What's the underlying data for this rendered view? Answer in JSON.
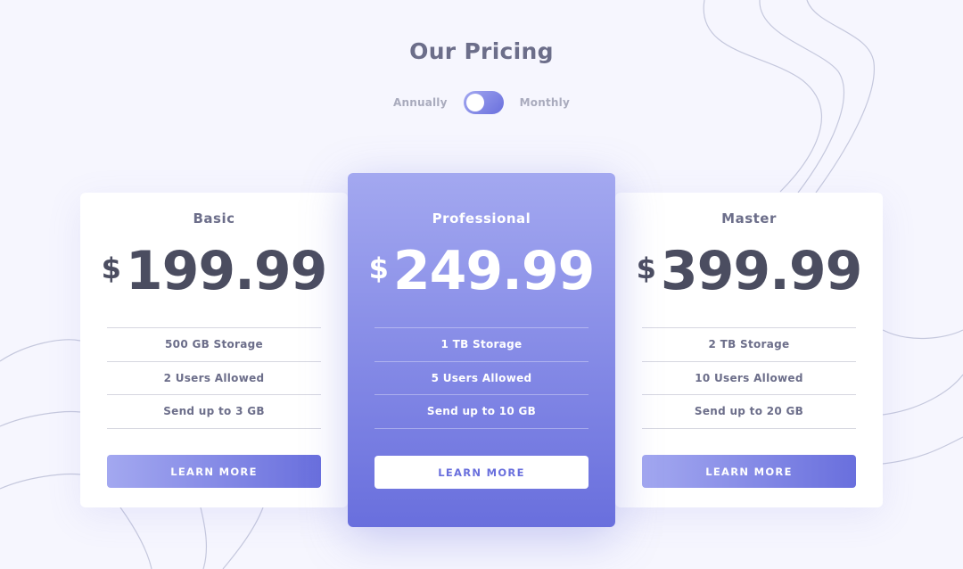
{
  "page": {
    "title": "Our Pricing"
  },
  "toggle": {
    "left_label": "Annually",
    "right_label": "Monthly",
    "state": "Monthly"
  },
  "plans": [
    {
      "name": "Basic",
      "currency": "$",
      "price": "199.99",
      "features": [
        "500 GB Storage",
        "2 Users Allowed",
        "Send up to 3 GB"
      ],
      "button_label": "LEARN MORE"
    },
    {
      "name": "Professional",
      "currency": "$",
      "price": "249.99",
      "features": [
        "1 TB Storage",
        "5 Users Allowed",
        "Send up to 10 GB"
      ],
      "button_label": "LEARN MORE"
    },
    {
      "name": "Master",
      "currency": "$",
      "price": "399.99",
      "features": [
        "2 TB Storage",
        "10 Users Allowed",
        "Send up to 20 GB"
      ],
      "button_label": "LEARN MORE"
    }
  ],
  "colors": {
    "background": "#f6f6fe",
    "gradient_start": "#a3a8f0",
    "gradient_end": "#696fdd",
    "heading": "#4b4d60",
    "muted": "#6c6e8a"
  }
}
